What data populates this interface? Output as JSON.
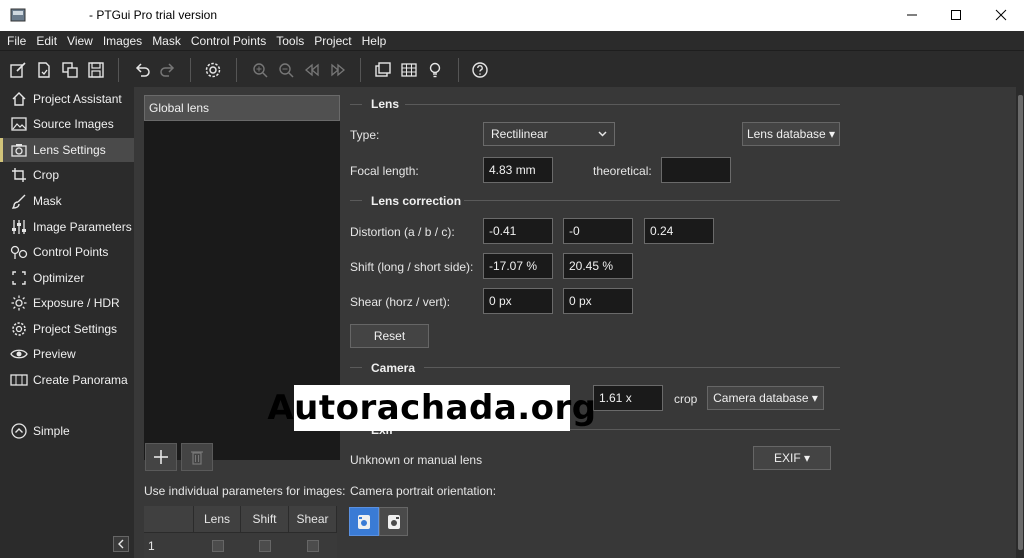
{
  "window": {
    "title": "- PTGui Pro trial version"
  },
  "menu": [
    "File",
    "Edit",
    "View",
    "Images",
    "Mask",
    "Control Points",
    "Tools",
    "Project",
    "Help"
  ],
  "toolbar": {
    "icons": [
      "new-project-icon",
      "open-project-icon",
      "save-as-icon",
      "save-icon",
      "undo-icon",
      "redo-icon",
      "settings-icon",
      "zoom-in-icon",
      "zoom-out-icon",
      "previous-icon",
      "next-icon",
      "panorama-editor-icon",
      "table-icon",
      "lightbulb-icon",
      "help-icon"
    ]
  },
  "sidebar": {
    "items": [
      {
        "label": "Project Assistant",
        "icon": "home-icon"
      },
      {
        "label": "Source Images",
        "icon": "image-icon"
      },
      {
        "label": "Lens Settings",
        "icon": "camera-icon",
        "active": true
      },
      {
        "label": "Crop",
        "icon": "crop-icon"
      },
      {
        "label": "Mask",
        "icon": "brush-icon"
      },
      {
        "label": "Image Parameters",
        "icon": "sliders-icon"
      },
      {
        "label": "Control Points",
        "icon": "control-points-icon"
      },
      {
        "label": "Optimizer",
        "icon": "optimizer-icon"
      },
      {
        "label": "Exposure / HDR",
        "icon": "sun-icon"
      },
      {
        "label": "Project Settings",
        "icon": "gear-icon"
      },
      {
        "label": "Preview",
        "icon": "eye-icon"
      },
      {
        "label": "Create Panorama",
        "icon": "panorama-icon"
      }
    ],
    "simple_label": "Simple"
  },
  "lens_list": {
    "header": "Global lens"
  },
  "individual_params_label": "Use individual parameters for images:",
  "table": {
    "columns": [
      "Lens",
      "Shift",
      "Shear"
    ],
    "rows": [
      {
        "index": "1"
      }
    ]
  },
  "lens": {
    "section": "Lens",
    "type_label": "Type:",
    "type_value": "Rectilinear",
    "lens_database": "Lens database ▾",
    "focal_label": "Focal length:",
    "focal_value": "4.83 mm",
    "theoretical_label": "theoretical:",
    "theoretical_value": ""
  },
  "lens_correction": {
    "section": "Lens correction",
    "distortion_label": "Distortion (a / b / c):",
    "a": "-0.41",
    "b": "-0",
    "c": "0.24",
    "shift_label": "Shift (long / short side):",
    "shift_long": "-17.07 %",
    "shift_short": "20.45 %",
    "shear_label": "Shear (horz / vert):",
    "shear_h": "0 px",
    "shear_v": "0 px",
    "reset": "Reset"
  },
  "camera": {
    "section": "Camera",
    "crop_value": "1.61 x",
    "crop_label": "crop",
    "camera_database": "Camera database ▾",
    "exif_section": "Exif",
    "exif_text": "Unknown or manual lens",
    "exif_button": "EXIF ▾",
    "portrait_label": "Camera portrait orientation:"
  },
  "watermark": "Autorachada.org",
  "colors": {
    "accent": "#3a7bd5",
    "active_bar": "#d2c47a",
    "background": "#383838"
  }
}
